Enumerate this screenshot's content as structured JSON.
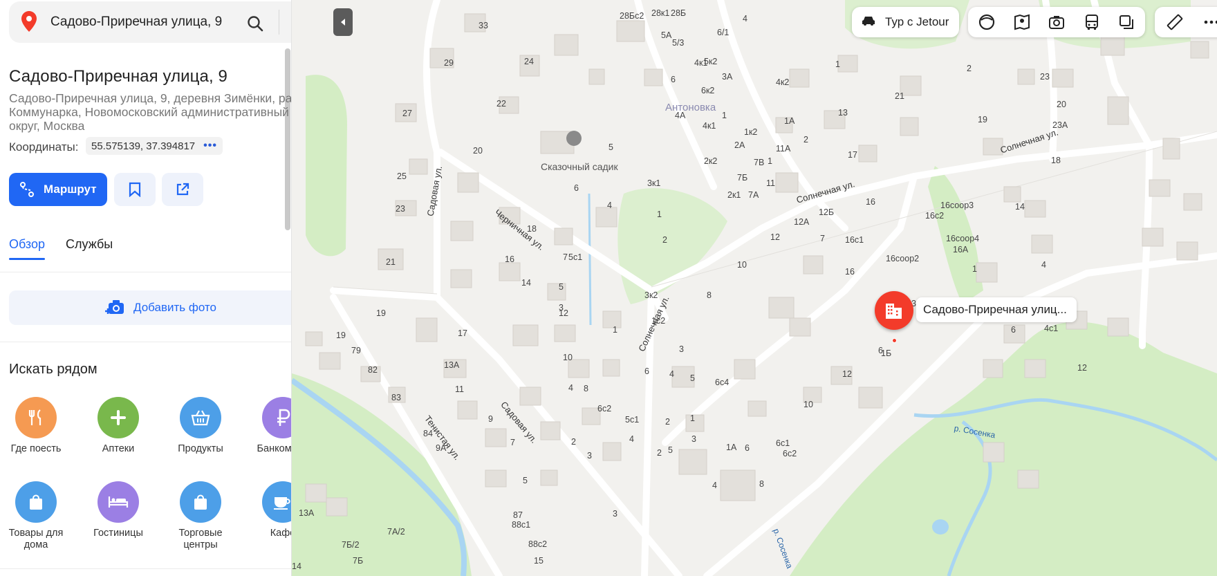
{
  "search": {
    "query": "Садово-Приречная улица, 9"
  },
  "place": {
    "title": "Садово-Приречная улица, 9",
    "address": "Садово-Приречная улица, 9, деревня Зимёнки, район Коммунарка, Новомосковский административный округ, Москва",
    "coords_label": "Координаты:",
    "coords_value": "55.575139, 37.394817"
  },
  "actions": {
    "route_label": "Маршрут"
  },
  "tabs": [
    {
      "label": "Обзор",
      "active": true
    },
    {
      "label": "Службы",
      "active": false
    }
  ],
  "add_photo_label": "Добавить фото",
  "nearby": {
    "title": "Искать рядом",
    "categories": [
      {
        "label": "Где поесть",
        "color": "#f59a52",
        "icon": "fork-knife-icon"
      },
      {
        "label": "Аптеки",
        "color": "#79b84c",
        "icon": "plus-icon"
      },
      {
        "label": "Продукты",
        "color": "#4d9fe8",
        "icon": "basket-icon"
      },
      {
        "label": "Банкоматы",
        "color": "#9b7fe4",
        "icon": "ruble-icon"
      },
      {
        "label": "Товары для дома",
        "color": "#4d9fe8",
        "icon": "shopping-bag-icon"
      },
      {
        "label": "Гостиницы",
        "color": "#9b7fe4",
        "icon": "bed-icon"
      },
      {
        "label": "Торговые центры",
        "color": "#4d9fe8",
        "icon": "shopping-bag-icon"
      },
      {
        "label": "Кафе",
        "color": "#4d9fe8",
        "icon": "coffee-cup-icon"
      }
    ]
  },
  "map": {
    "ad_label": "Тур с Jetour",
    "marker_label": "Садово-Приречная улиц...",
    "district": "Антоновка",
    "poi": "Сказочный садик",
    "streets": [
      "Садовая ул.",
      "Черничная ул.",
      "Солнечная ул.",
      "Солнечная ул.",
      "Садовая ул.",
      "Тенистая ул.",
      "Солнечная ул."
    ],
    "rivers": [
      "р. Сосенка",
      "р. Сосенка"
    ],
    "house_numbers": [
      "33",
      "29",
      "24",
      "22",
      "27",
      "20",
      "25",
      "23",
      "21",
      "19",
      "19",
      "79",
      "82",
      "83",
      "84",
      "17",
      "13А",
      "11",
      "9",
      "9А",
      "7",
      "5",
      "3",
      "87",
      "88с1",
      "88с2",
      "15",
      "7А/2",
      "7Б/2",
      "7Б",
      "13А",
      "14",
      "28Бс2",
      "28к1",
      "28Б",
      "5А",
      "5к2",
      "3А",
      "6",
      "4А",
      "4к1",
      "1к2",
      "2к2",
      "1",
      "2к1",
      "3к1",
      "5",
      "6",
      "4",
      "18",
      "16",
      "14",
      "12",
      "10",
      "8",
      "6с2",
      "4",
      "2",
      "1",
      "2",
      "3",
      "5с1",
      "7",
      "5",
      "3",
      "1",
      "1с2",
      "3к2",
      "5",
      "3",
      "5с1",
      "6",
      "4",
      "2",
      "3",
      "1",
      "1А",
      "4",
      "2",
      "5",
      "3",
      "4",
      "6с4",
      "6",
      "6с1",
      "6с2",
      "8",
      "10",
      "12",
      "6",
      "8",
      "10",
      "12",
      "12А",
      "12Б",
      "7",
      "7А",
      "7Б",
      "7В",
      "11",
      "11А",
      "2",
      "2А",
      "1",
      "1А",
      "4к2",
      "4к1",
      "6к2",
      "6/1",
      "5/3",
      "4",
      "1",
      "2",
      "13",
      "17",
      "21",
      "19",
      "23А",
      "23",
      "20",
      "18",
      "14",
      "16",
      "16с2",
      "16с1",
      "16",
      "16соор2",
      "16соор3",
      "16соор4",
      "16А",
      "1",
      "4",
      "6",
      "4с1",
      "12",
      "1Б"
    ]
  }
}
